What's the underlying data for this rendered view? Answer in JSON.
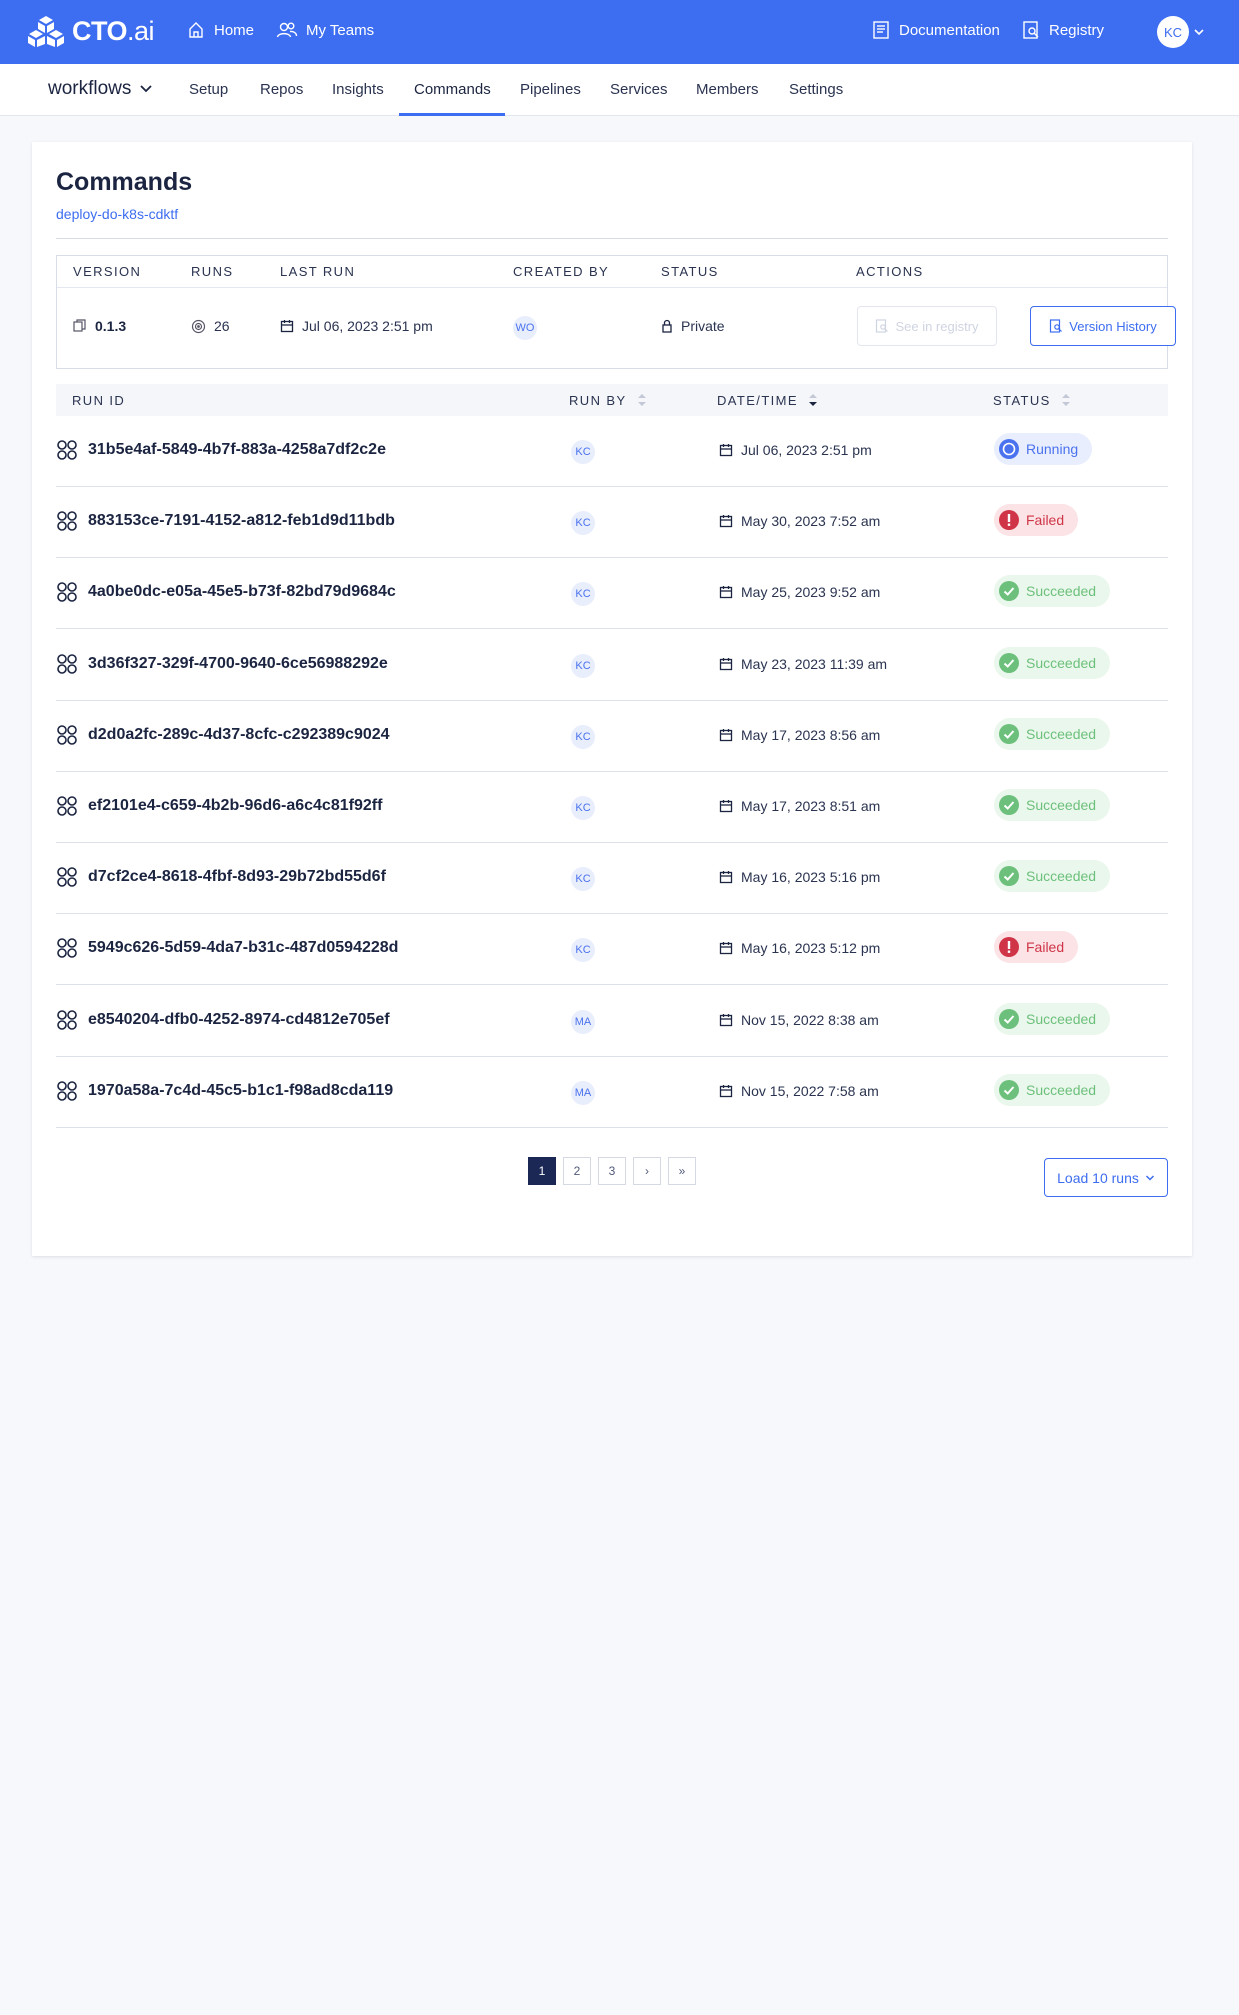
{
  "brand": {
    "name_main": "CTO",
    "name_suffix": ".ai"
  },
  "topnav": {
    "home": "Home",
    "my_teams": "My Teams",
    "documentation": "Documentation",
    "registry": "Registry",
    "user_initials": "KC"
  },
  "workspace": {
    "name": "workflows"
  },
  "tabs": [
    "Setup",
    "Repos",
    "Insights",
    "Commands",
    "Pipelines",
    "Services",
    "Members",
    "Settings"
  ],
  "active_tab": "Commands",
  "page": {
    "title": "Commands",
    "command_name": "deploy-do-k8s-cdktf"
  },
  "meta_table": {
    "headers": {
      "version": "VERSION",
      "runs": "RUNS",
      "last_run": "LAST RUN",
      "created_by": "CREATED BY",
      "status": "STATUS",
      "actions": "ACTIONS"
    },
    "version": "0.1.3",
    "runs": "26",
    "last_run": "Jul 06, 2023 2:51 pm",
    "created_by": "WO",
    "status": "Private",
    "see_in_registry": "See in registry",
    "version_history": "Version History"
  },
  "runs_table": {
    "headers": {
      "run_id": "RUN ID",
      "run_by": "RUN BY",
      "date_time": "DATE/TIME",
      "status": "STATUS"
    },
    "rows": [
      {
        "id": "31b5e4af-5849-4b7f-883a-4258a7df2c2e",
        "by": "KC",
        "date": "Jul 06, 2023 2:51 pm",
        "status": "Running"
      },
      {
        "id": "883153ce-7191-4152-a812-feb1d9d11bdb",
        "by": "KC",
        "date": "May 30, 2023 7:52 am",
        "status": "Failed"
      },
      {
        "id": "4a0be0dc-e05a-45e5-b73f-82bd79d9684c",
        "by": "KC",
        "date": "May 25, 2023 9:52 am",
        "status": "Succeeded"
      },
      {
        "id": "3d36f327-329f-4700-9640-6ce56988292e",
        "by": "KC",
        "date": "May 23, 2023 11:39 am",
        "status": "Succeeded"
      },
      {
        "id": "d2d0a2fc-289c-4d37-8cfc-c292389c9024",
        "by": "KC",
        "date": "May 17, 2023 8:56 am",
        "status": "Succeeded"
      },
      {
        "id": "ef2101e4-c659-4b2b-96d6-a6c4c81f92ff",
        "by": "KC",
        "date": "May 17, 2023 8:51 am",
        "status": "Succeeded"
      },
      {
        "id": "d7cf2ce4-8618-4fbf-8d93-29b72bd55d6f",
        "by": "KC",
        "date": "May 16, 2023 5:16 pm",
        "status": "Succeeded"
      },
      {
        "id": "5949c626-5d59-4da7-b31c-487d0594228d",
        "by": "KC",
        "date": "May 16, 2023 5:12 pm",
        "status": "Failed"
      },
      {
        "id": "e8540204-dfb0-4252-8974-cd4812e705ef",
        "by": "MA",
        "date": "Nov 15, 2022 8:38 am",
        "status": "Succeeded"
      },
      {
        "id": "1970a58a-7c4d-45c5-b1c1-f98ad8cda119",
        "by": "MA",
        "date": "Nov 15, 2022 7:58 am",
        "status": "Succeeded"
      }
    ]
  },
  "pagination": {
    "pages": [
      "1",
      "2",
      "3"
    ],
    "next": "›",
    "last": "»",
    "current": "1"
  },
  "load_more": "Load 10 runs",
  "colors": {
    "primary": "#3d6df0",
    "navy": "#1b2440",
    "running": "#4a72ee",
    "failed": "#cf3547",
    "succeeded": "#6cc07b"
  }
}
